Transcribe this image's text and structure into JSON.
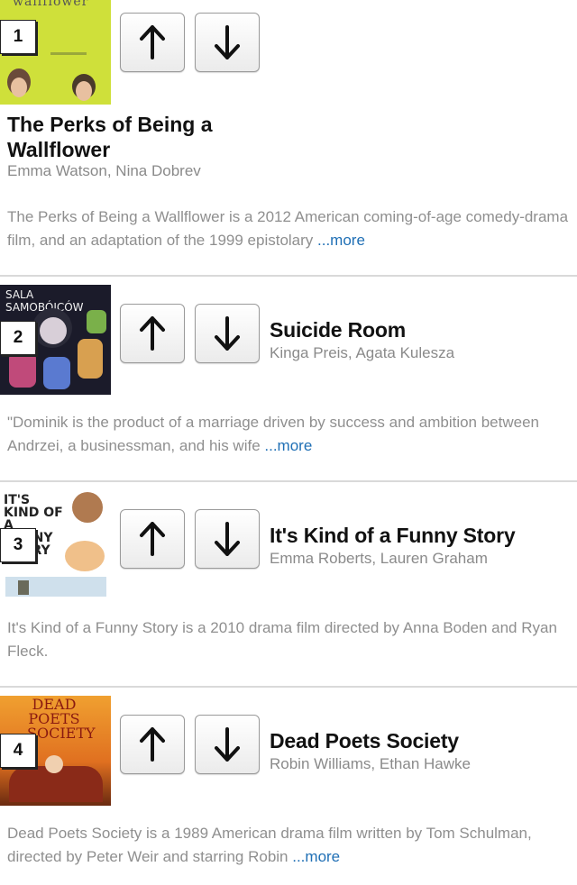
{
  "items": [
    {
      "rank": "1",
      "poster_text": "wallflower",
      "title": "The Perks of Being a Wallflower",
      "cast": "Emma Watson, Nina Dobrev",
      "description": "The Perks of Being a Wallflower is a 2012 American coming-of-age comedy-drama film, and an adaptation of the 1999 epistolary ",
      "more_label": "...more"
    },
    {
      "rank": "2",
      "poster_text": "SALA SAMOBÓJCÓW",
      "title": "Suicide Room",
      "cast": "Kinga Preis, Agata Kulesza",
      "description": "\"Dominik is the product of a marriage driven by success and ambition between Andrzei, a businessman, and his wife ",
      "more_label": "...more"
    },
    {
      "rank": "3",
      "poster_text": "IT'S KIND OF A FUNNY STORY",
      "title": "It's Kind of a Funny Story",
      "cast": "Emma Roberts, Lauren Graham",
      "description": "It's Kind of a Funny Story is a 2010 drama film directed by Anna Boden and Ryan Fleck.",
      "more_label": ""
    },
    {
      "rank": "4",
      "poster_text": "DEAD POETS SOCIETY",
      "title": "Dead Poets Society",
      "cast": "Robin Williams, Ethan Hawke",
      "description": "Dead Poets Society is a 1989 American drama film written by Tom Schulman, directed by Peter Weir and starring Robin ",
      "more_label": "...more"
    }
  ],
  "icons": {
    "up": "arrow-up-icon",
    "down": "arrow-down-icon"
  },
  "colors": {
    "link": "#1f6fb5",
    "muted": "#8f8f8f",
    "separator": "#d9d9d9"
  }
}
